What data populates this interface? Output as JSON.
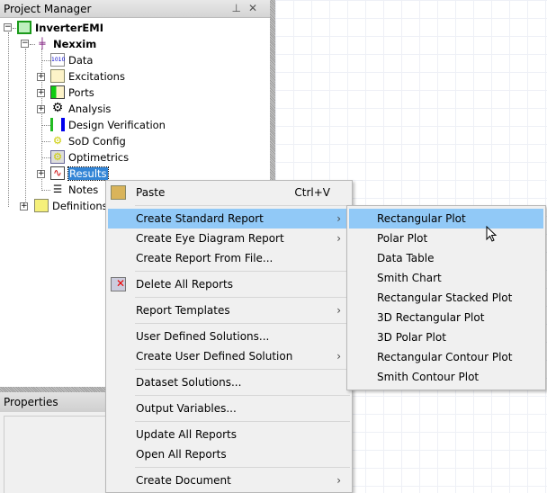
{
  "project_manager": {
    "title": "Project Manager",
    "pin": "📌",
    "close": "✕"
  },
  "tree": {
    "project": "InverterEMI",
    "design": "Nexxim",
    "items": [
      "Data",
      "Excitations",
      "Ports",
      "Analysis",
      "Design Verification",
      "SoD Config",
      "Optimetrics",
      "Results",
      "Notes"
    ],
    "definitions": "Definitions"
  },
  "properties": {
    "title": "Properties"
  },
  "context_menu": {
    "paste": "Paste",
    "paste_shortcut": "Ctrl+V",
    "create_standard_report": "Create Standard Report",
    "create_eye_diagram_report": "Create Eye Diagram Report",
    "create_report_from_file": "Create Report From File...",
    "delete_all_reports": "Delete All Reports",
    "report_templates": "Report Templates",
    "user_defined_solutions": "User Defined Solutions...",
    "create_user_defined_solution": "Create User Defined Solution",
    "dataset_solutions": "Dataset Solutions...",
    "output_variables": "Output Variables...",
    "update_all_reports": "Update All Reports",
    "open_all_reports": "Open All Reports",
    "create_document": "Create Document",
    "arrow": "›"
  },
  "submenu": {
    "items": [
      "Rectangular Plot",
      "Polar Plot",
      "Data Table",
      "Smith Chart",
      "Rectangular Stacked Plot",
      "3D Rectangular Plot",
      "3D Polar Plot",
      "Rectangular Contour Plot",
      "Smith Contour Plot"
    ]
  }
}
